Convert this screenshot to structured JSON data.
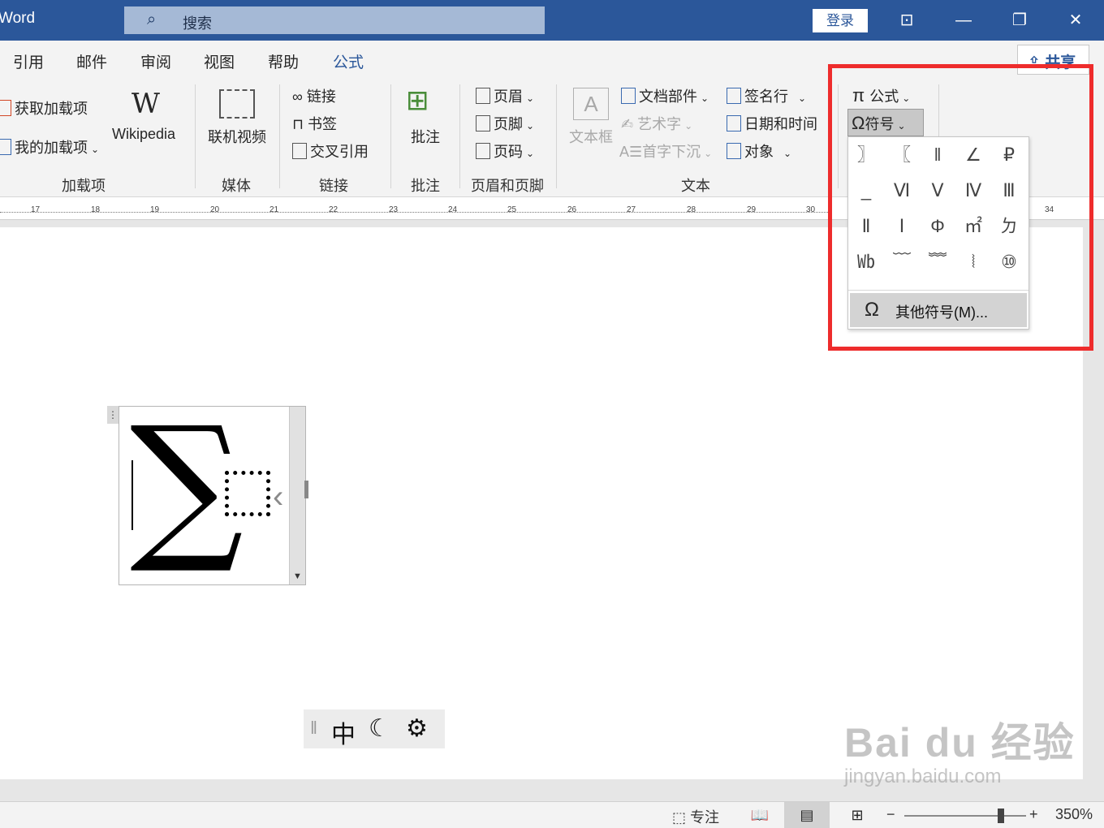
{
  "titlebar": {
    "app_title": "Word",
    "search_placeholder": "搜索",
    "login": "登录"
  },
  "tabs": [
    "引用",
    "邮件",
    "审阅",
    "视图",
    "帮助",
    "公式"
  ],
  "share_label": "共享",
  "ribbon": {
    "addins": {
      "get": "获取加载项",
      "mine": "我的加载项",
      "wikipedia": "Wikipedia",
      "group": "加载项"
    },
    "media": {
      "online_video": "联机视频",
      "group": "媒体"
    },
    "links": {
      "link": "链接",
      "bookmark": "书签",
      "crossref": "交叉引用",
      "group": "链接"
    },
    "comments": {
      "comment": "批注",
      "group": "批注"
    },
    "headerfooter": {
      "header": "页眉",
      "footer": "页脚",
      "pagenum": "页码",
      "group": "页眉和页脚"
    },
    "text": {
      "textbox": "文本框",
      "parts": "文档部件",
      "wordart": "艺术字",
      "dropcap": "首字下沉",
      "signature": "签名行",
      "datetime": "日期和时间",
      "object": "对象",
      "group": "文本"
    },
    "symbols": {
      "equation": "公式",
      "symbol": "符号"
    }
  },
  "ruler": [
    "17",
    "18",
    "19",
    "20",
    "21",
    "22",
    "23",
    "24",
    "25",
    "26",
    "27",
    "28",
    "29",
    "30",
    "34"
  ],
  "symbol_grid": [
    "〗",
    "〖",
    "‖",
    "∠",
    "₽",
    "_",
    "Ⅵ",
    "Ⅴ",
    "Ⅳ",
    "Ⅲ",
    "Ⅱ",
    "Ⅰ",
    "Φ",
    "㎡",
    "ㄉ",
    "㏝",
    "﹋",
    "﹌",
    "⦚",
    "⑩"
  ],
  "more_symbols": "其他符号(M)...",
  "equation": {
    "sigma": "∑"
  },
  "ime": {
    "mode": "中"
  },
  "status": {
    "focus": "专注",
    "zoom": "350%"
  },
  "watermark": {
    "main": "Bai du 经验",
    "sub": "jingyan.baidu.com"
  },
  "colors": {
    "title_bar": "#2b579a",
    "highlight": "#ee2c2c",
    "active_tab": "#2b579a"
  }
}
